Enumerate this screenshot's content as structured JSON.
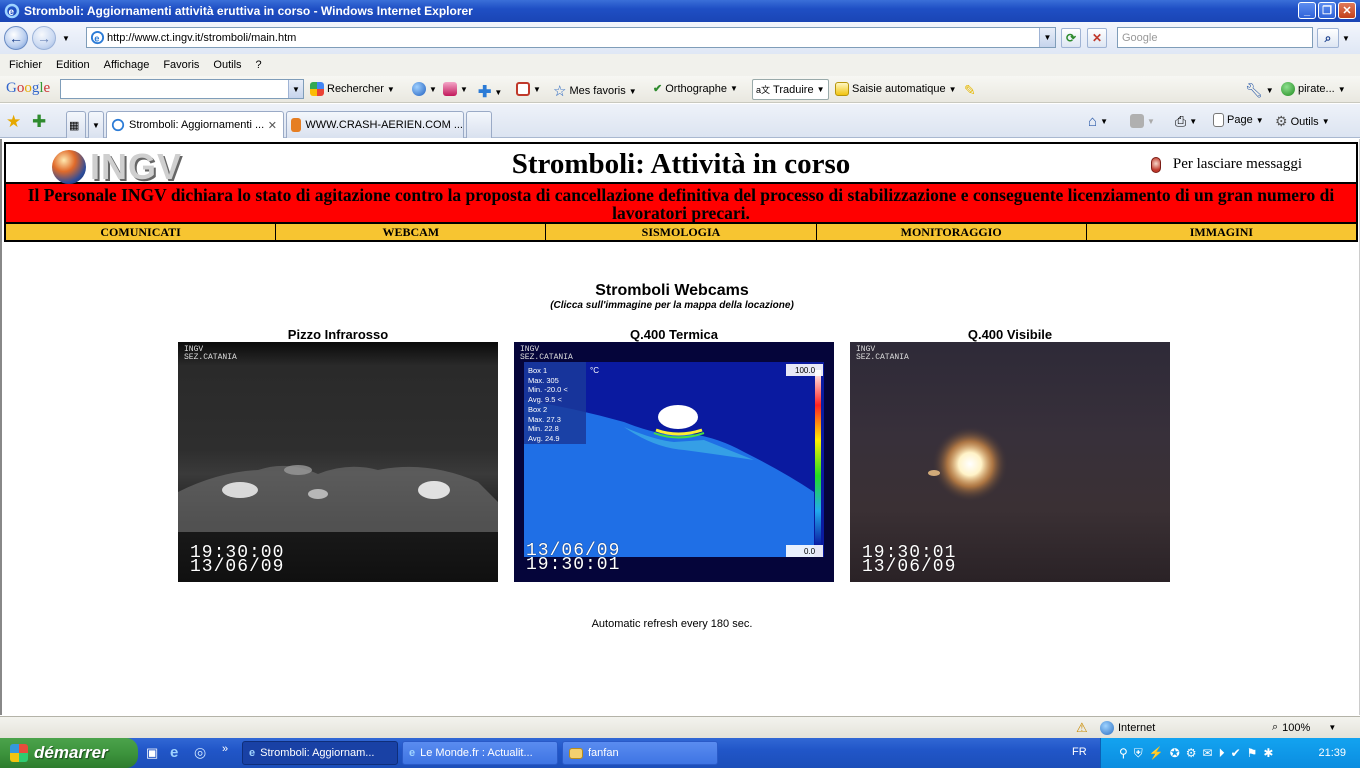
{
  "window": {
    "title": "Stromboli: Aggiornamenti attività eruttiva in corso - Windows Internet Explorer"
  },
  "address": {
    "url": "http://www.ct.ingv.it/stromboli/main.htm",
    "search_placeholder": "Google"
  },
  "menu": [
    "Fichier",
    "Edition",
    "Affichage",
    "Favoris",
    "Outils",
    "?"
  ],
  "google_toolbar": {
    "logo": "Google",
    "search": "Rechercher",
    "favorites": "Mes favoris",
    "spell": "Orthographe",
    "translate": "Traduire",
    "autofill": "Saisie automatique",
    "account": "pirate..."
  },
  "tabs": [
    {
      "label": "Stromboli: Aggiornamenti ...",
      "active": true
    },
    {
      "label": "WWW.CRASH-AERIEN.COM ...",
      "active": false
    }
  ],
  "command_bar": {
    "page": "Page",
    "tools": "Outils"
  },
  "page": {
    "logo": "INGV",
    "title": "Stromboli: Attività in corso",
    "message_link": "Per lasciare messaggi",
    "banner": "Il Personale INGV dichiara lo stato di agitazione  contro la proposta di cancellazione definitiva del processo di stabilizzazione e conseguente licenziamento di un gran numero di lavoratori precari.",
    "nav": [
      "COMUNICATI",
      "WEBCAM",
      "SISMOLOGIA",
      "MONITORAGGIO",
      "IMMAGINI"
    ],
    "webcams_title": "Stromboli Webcams",
    "webcams_subtitle": "(Clicca sull'immagine per la mappa della locazione)",
    "cams": [
      {
        "label": "Pizzo Infrarosso",
        "time": "19:30:00",
        "date": "13/06/09"
      },
      {
        "label": "Q.400 Termica",
        "time": "19:30:01",
        "date": "13/06/09"
      },
      {
        "label": "Q.400 Visibile",
        "time": "19:30:01",
        "date": "13/06/09"
      }
    ],
    "cam_watermark": "INGV",
    "cam_watermark_sub": "SEZ.CATANIA",
    "thermal": {
      "unit": "°C",
      "scale_max": "100.0",
      "scale_min": "0.0",
      "box1_title": "Box 1",
      "box1_max": "Max. 305",
      "box1_min": "Min. -20.0 <",
      "box1_avg": "Avg. 9.5 <",
      "box2_title": "Box 2",
      "box2_max": "Max. 27.3",
      "box2_min": "Min. 22.8",
      "box2_avg": "Avg. 24.9"
    },
    "refresh_note": "Automatic refresh every 180 sec."
  },
  "status": {
    "zone": "Internet",
    "zoom": "100%"
  },
  "taskbar": {
    "start": "démarrer",
    "buttons": [
      {
        "label": "Stromboli: Aggiornam...",
        "active": true
      },
      {
        "label": "Le Monde.fr : Actualit...",
        "active": false
      },
      {
        "label": "fanfan",
        "active": false
      }
    ],
    "lang": "FR",
    "clock": "21:39"
  },
  "colors": {
    "banner": "#ff0000",
    "nav": "#f7c531",
    "xp_blue": "#2156c8"
  }
}
